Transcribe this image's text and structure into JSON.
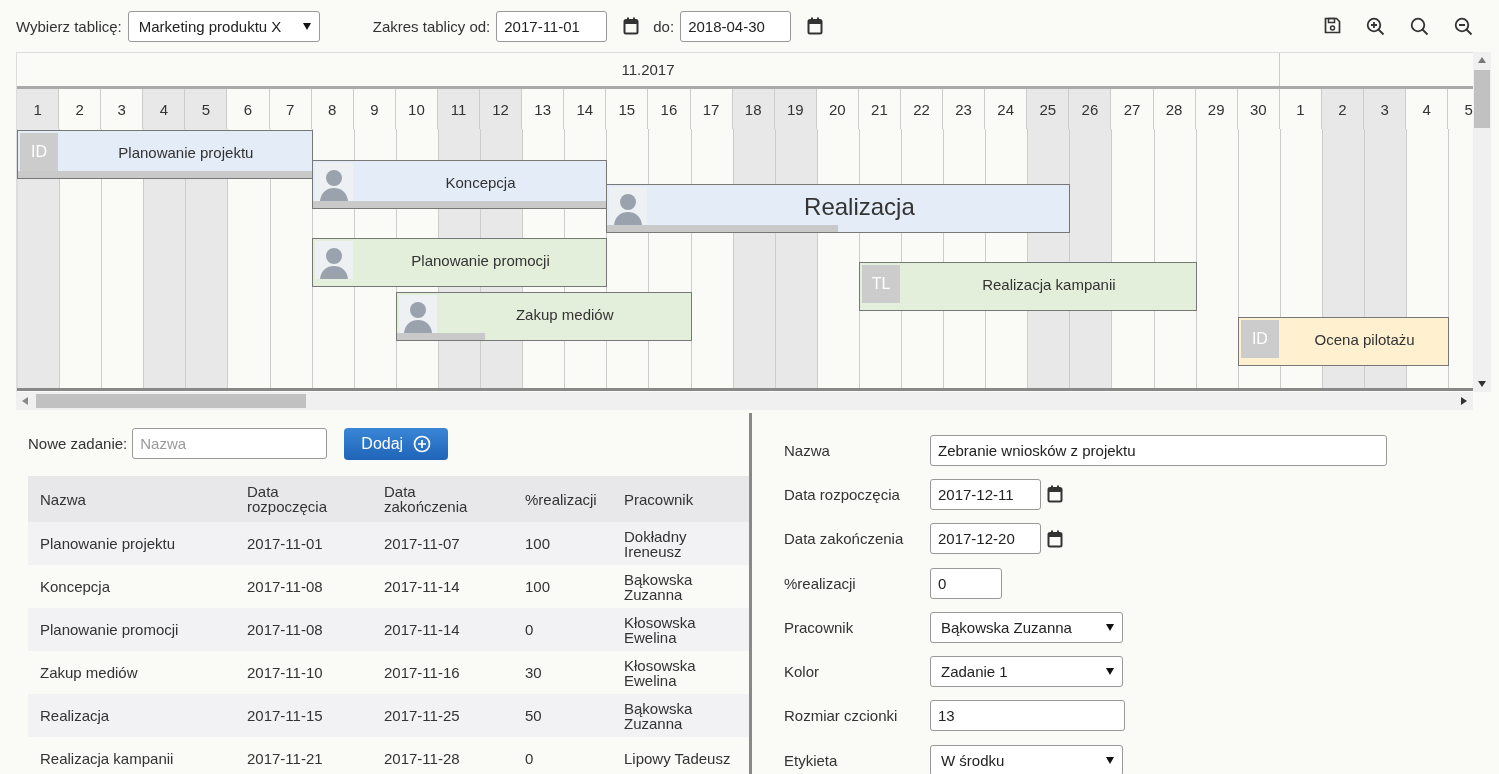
{
  "toolbar": {
    "board_label": "Wybierz tablicę:",
    "board_select": "Marketing produktu X",
    "range_label": "Zakres tablicy od:",
    "range_from": "2017-11-01",
    "to_label": "do:",
    "range_to": "2018-04-30"
  },
  "gantt": {
    "months": [
      "11.2017"
    ],
    "days": [
      {
        "label": "1",
        "shaded": true
      },
      {
        "label": "2",
        "shaded": false
      },
      {
        "label": "3",
        "shaded": false
      },
      {
        "label": "4",
        "shaded": true
      },
      {
        "label": "5",
        "shaded": true
      },
      {
        "label": "6",
        "shaded": false
      },
      {
        "label": "7",
        "shaded": false
      },
      {
        "label": "8",
        "shaded": false
      },
      {
        "label": "9",
        "shaded": false
      },
      {
        "label": "10",
        "shaded": false
      },
      {
        "label": "11",
        "shaded": true
      },
      {
        "label": "12",
        "shaded": true
      },
      {
        "label": "13",
        "shaded": false
      },
      {
        "label": "14",
        "shaded": false
      },
      {
        "label": "15",
        "shaded": false
      },
      {
        "label": "16",
        "shaded": false
      },
      {
        "label": "17",
        "shaded": false
      },
      {
        "label": "18",
        "shaded": true
      },
      {
        "label": "19",
        "shaded": true
      },
      {
        "label": "20",
        "shaded": false
      },
      {
        "label": "21",
        "shaded": false
      },
      {
        "label": "22",
        "shaded": false
      },
      {
        "label": "23",
        "shaded": false
      },
      {
        "label": "24",
        "shaded": false
      },
      {
        "label": "25",
        "shaded": true
      },
      {
        "label": "26",
        "shaded": true
      },
      {
        "label": "27",
        "shaded": false
      },
      {
        "label": "28",
        "shaded": false
      },
      {
        "label": "29",
        "shaded": false
      },
      {
        "label": "30",
        "shaded": false
      },
      {
        "label": "1",
        "shaded": false
      },
      {
        "label": "2",
        "shaded": true
      },
      {
        "label": "3",
        "shaded": true
      },
      {
        "label": "4",
        "shaded": false
      },
      {
        "label": "5",
        "shaded": false
      }
    ],
    "bars": [
      {
        "label": "Planowanie projektu",
        "avatar": {
          "kind": "initials",
          "text": "ID"
        },
        "color": "#e3ecf7",
        "level": 1,
        "emphasized": false
      },
      {
        "label": "Koncepcja",
        "avatar": {
          "kind": "photo"
        },
        "color": "#e3ecf7",
        "level": 1,
        "emphasized": false
      },
      {
        "label": "Realizacja",
        "avatar": {
          "kind": "photo"
        },
        "color": "#e3ecf7",
        "level": 0.5,
        "emphasized": true
      },
      {
        "label": "Planowanie promocji",
        "avatar": {
          "kind": "photo"
        },
        "color": "#e3efdb",
        "emphasized": false
      },
      {
        "label": "Realizacja kampanii",
        "avatar": {
          "kind": "initials",
          "text": "TL"
        },
        "color": "#e3efdb",
        "emphasized": false
      },
      {
        "label": "Zakup mediów",
        "avatar": {
          "kind": "photo"
        },
        "color": "#e3efdb",
        "level": 0.3,
        "emphasized": false
      },
      {
        "label": "Ocena pilotażu",
        "avatar": {
          "kind": "initials",
          "text": "ID"
        },
        "color": "#fff1cf",
        "emphasized": false
      }
    ]
  },
  "new_task": {
    "label": "Nowe zadanie:",
    "placeholder": "Nazwa",
    "button": "Dodaj"
  },
  "table": {
    "columns": [
      "Nazwa",
      "Data rozpoczęcia",
      "Data zakończenia",
      "%realizacji",
      "Pracownik"
    ],
    "rows": [
      [
        "Planowanie projektu",
        "2017-11-01",
        "2017-11-07",
        "100",
        "Dokładny Ireneusz"
      ],
      [
        "Koncepcja",
        "2017-11-08",
        "2017-11-14",
        "100",
        "Bąkowska Zuzanna"
      ],
      [
        "Planowanie promocji",
        "2017-11-08",
        "2017-11-14",
        "0",
        "Kłosowska Ewelina"
      ],
      [
        "Zakup mediów",
        "2017-11-10",
        "2017-11-16",
        "30",
        "Kłosowska Ewelina"
      ],
      [
        "Realizacja",
        "2017-11-15",
        "2017-11-25",
        "50",
        "Bąkowska Zuzanna"
      ],
      [
        "Realizacja kampanii",
        "2017-11-21",
        "2017-11-28",
        "0",
        "Lipowy Tadeusz"
      ]
    ]
  },
  "details": {
    "fields": [
      {
        "label": "Nazwa",
        "kind": "text",
        "value": "Zebranie wniosków z projektu"
      },
      {
        "label": "Data rozpoczęcia",
        "kind": "date",
        "value": "2017-12-11"
      },
      {
        "label": "Data zakończenia",
        "kind": "date",
        "value": "2017-12-20"
      },
      {
        "label": "%realizacji",
        "kind": "short",
        "value": "0"
      },
      {
        "label": "Pracownik",
        "kind": "select",
        "value": "Bąkowska Zuzanna"
      },
      {
        "label": "Kolor",
        "kind": "select",
        "value": "Zadanie 1"
      },
      {
        "label": "Rozmiar czcionki",
        "kind": "number",
        "value": "13"
      },
      {
        "label": "Etykieta",
        "kind": "select",
        "value": "W środku"
      }
    ]
  }
}
